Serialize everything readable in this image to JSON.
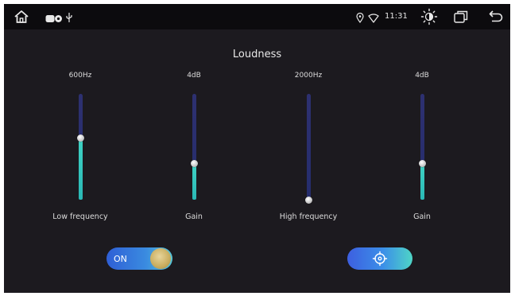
{
  "status_bar": {
    "time": "11:31",
    "left_icons": [
      "home-icon",
      "media-indicator-icon",
      "usb-icon"
    ],
    "right_icons": [
      "location-icon",
      "wifi-icon",
      "brightness-icon",
      "recent-apps-icon",
      "back-icon"
    ]
  },
  "screen": {
    "title": "Loudness"
  },
  "sliders": [
    {
      "value_label": "600Hz",
      "label": "Low frequency",
      "level": 0.58
    },
    {
      "value_label": "4dB",
      "label": "Gain",
      "level": 0.34
    },
    {
      "value_label": "2000Hz",
      "label": "High frequency",
      "level": 0.0
    },
    {
      "value_label": "4dB",
      "label": "Gain",
      "level": 0.34
    }
  ],
  "controls": {
    "toggle_label": "ON",
    "toggle_state": "on",
    "reset_icon": "target-icon"
  },
  "colors": {
    "background": "#1c1a1f",
    "status_bar": "#0c0b0e",
    "track": "#2a2f6e",
    "fill": "#38c7bd",
    "accent": "#3a8be0"
  }
}
